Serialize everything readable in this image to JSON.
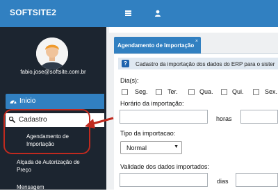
{
  "header": {
    "brand": "SOFTSITE2",
    "icons": [
      "menu-icon",
      "user-icon"
    ]
  },
  "sidebar": {
    "user_email": "fabio.jose@softsite.com.br",
    "nav": [
      {
        "label": "Inicio",
        "icon": "dashboard-icon"
      },
      {
        "label": "Cadastro",
        "icon": "wrench-icon"
      }
    ],
    "submenu": [
      {
        "line1": "Agendamento de",
        "line2": "Importação"
      },
      {
        "line1": "Alçada de Autorização de",
        "line2": "Preço"
      },
      {
        "line1": "Mensagem",
        "line2": ""
      }
    ]
  },
  "tab": {
    "label": "Agendamento de Importação",
    "close": "×"
  },
  "info": {
    "text": "Cadastro da importação dos dados do ERP para o sister"
  },
  "form": {
    "days_label": "Dia(s):",
    "days": [
      "Seg.",
      "Ter.",
      "Qua.",
      "Qui.",
      "Sex."
    ],
    "time_label": "Horário da importação:",
    "hours_label": "horas",
    "type_label": "Tipo da importacao:",
    "type_value": "Normal",
    "validity_label": "Validade dos dados importados:",
    "days_unit_label": "dias"
  },
  "colors": {
    "topbar": "#3180c1",
    "sidebar": "#1c2530",
    "annotation": "#c02a1f"
  }
}
